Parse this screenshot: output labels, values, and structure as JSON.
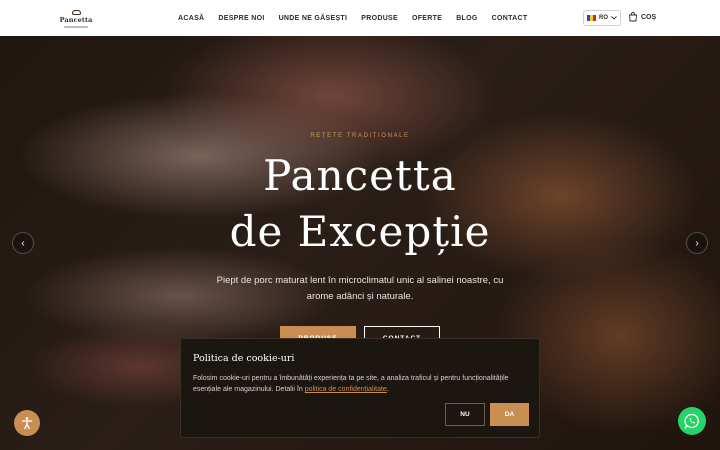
{
  "header": {
    "logo_text": "Pancetta",
    "nav": [
      "ACASĂ",
      "DESPRE NOI",
      "UNDE NE GĂSEȘTI",
      "PRODUSE",
      "OFERTE",
      "BLOG",
      "CONTACT"
    ],
    "language": "RO",
    "cart_label": "COȘ"
  },
  "hero": {
    "kicker": "REȚETE TRADIȚIONALE",
    "title_line1": "Pancetta",
    "title_line2": "de Excepție",
    "text": "Piept de porc maturat lent în microclimatul unic al salinei noastre, cu arome adânci și naturale.",
    "btn_products": "PRODUSE",
    "btn_contact": "CONTACT"
  },
  "cookie": {
    "title": "Politica de cookie-uri",
    "text": "Folosim cookie-uri pentru a îmbunătăți experiența ta pe site, a analiza traficul și pentru funcționalitățile esențiale ale magazinului. Detalii în",
    "link": "politica de confidențialitate",
    "end": ".",
    "no": "NU",
    "yes": "DA"
  },
  "colors": {
    "accent": "#c98f52",
    "whatsapp": "#25d366",
    "cookie_bg": "#1c1611"
  }
}
